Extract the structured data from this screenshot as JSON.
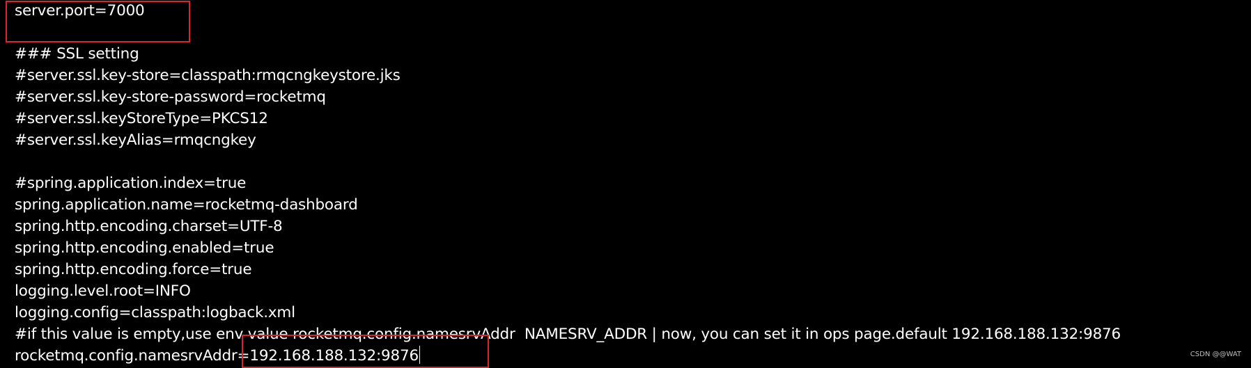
{
  "editor": {
    "lines": [
      "server.port=7000",
      "",
      "### SSL setting",
      "#server.ssl.key-store=classpath:rmqcngkeystore.jks",
      "#server.ssl.key-store-password=rocketmq",
      "#server.ssl.keyStoreType=PKCS12",
      "#server.ssl.keyAlias=rmqcngkey",
      "",
      "#spring.application.index=true",
      "spring.application.name=rocketmq-dashboard",
      "spring.http.encoding.charset=UTF-8",
      "spring.http.encoding.enabled=true",
      "spring.http.encoding.force=true",
      "logging.level.root=INFO",
      "logging.config=classpath:logback.xml",
      "#if this value is empty,use env value rocketmq.config.namesrvAddr  NAMESRV_ADDR | now, you can set it in ops page.default 192.168.188.132:9876",
      "rocketmq.config.namesrvAddr=192.168.188.132:9876"
    ]
  },
  "annotation_color": "#d9262e",
  "watermark": "CSDN @@WAT"
}
